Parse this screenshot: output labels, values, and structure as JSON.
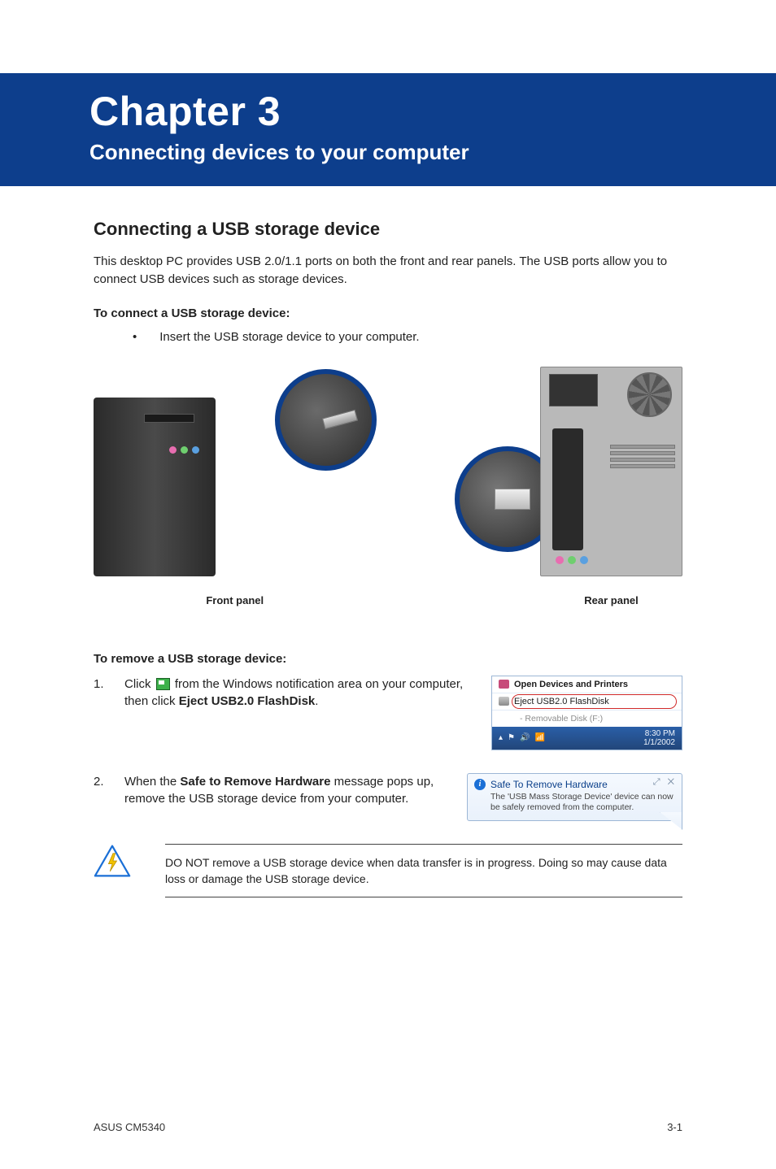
{
  "chapter": {
    "title": "Chapter 3",
    "subtitle": "Connecting devices to your computer"
  },
  "section": {
    "heading": "Connecting a USB storage device",
    "intro": "This desktop PC provides USB 2.0/1.1 ports on both the front and rear panels. The USB ports allow you to connect USB devices such as storage devices."
  },
  "connect": {
    "heading": "To connect a USB storage device:",
    "bullet": "Insert the USB storage device to your computer."
  },
  "panels": {
    "front_caption": "Front panel",
    "rear_caption": "Rear panel"
  },
  "remove": {
    "heading": "To remove a USB storage device:",
    "step1_num": "1.",
    "step1_pre": "Click ",
    "step1_mid": " from the Windows notification area on your computer, then click ",
    "step1_bold": "Eject USB2.0 FlashDisk",
    "step1_post": ".",
    "step2_num": "2.",
    "step2_pre": "When the ",
    "step2_bold": "Safe to Remove Hardware",
    "step2_post": " message pops up, remove the USB storage device from your computer."
  },
  "eject_menu": {
    "open_devices": "Open Devices and Printers",
    "eject": "Eject USB2.0 FlashDisk",
    "removable": "- Removable Disk (F:)",
    "tray_time": "8:30 PM",
    "tray_date": "1/1/2002"
  },
  "balloon": {
    "title": "Safe To Remove Hardware",
    "body": "The 'USB Mass Storage Device' device can now be safely removed from the computer."
  },
  "warning": {
    "text": "DO NOT remove a USB storage device when data transfer is in progress. Doing so may cause data loss or damage the USB storage device."
  },
  "footer": {
    "left": "ASUS CM5340",
    "right": "3-1"
  }
}
